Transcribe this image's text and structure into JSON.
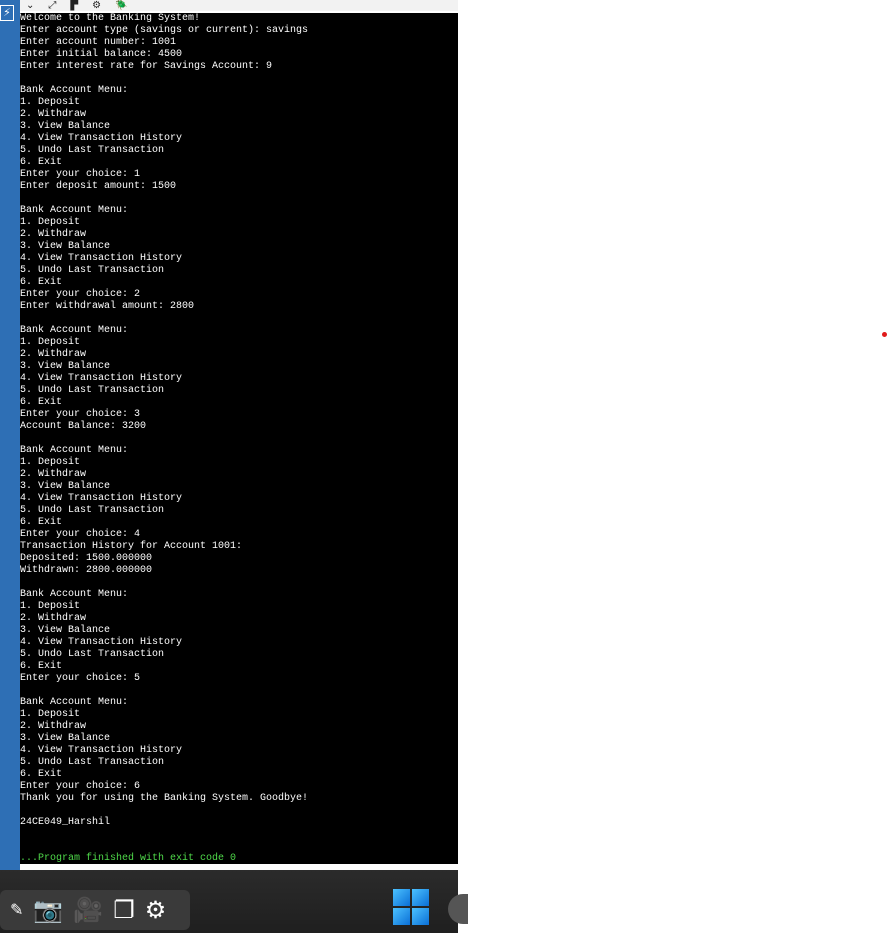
{
  "toolbar": {
    "icons": [
      "chevron-down-icon",
      "expand-icon",
      "format-icon",
      "gear-icon",
      "debug-icon"
    ],
    "glyphs": [
      "⌄",
      "⤢",
      "▛",
      "⚙",
      "🪲"
    ]
  },
  "sidebar": {
    "glyph": "⚡"
  },
  "console": {
    "lines": [
      "Welcome to the Banking System!",
      "Enter account type (savings or current): savings",
      "Enter account number: 1001",
      "Enter initial balance: 4500",
      "Enter interest rate for Savings Account: 9",
      "",
      "Bank Account Menu:",
      "1. Deposit",
      "2. Withdraw",
      "3. View Balance",
      "4. View Transaction History",
      "5. Undo Last Transaction",
      "6. Exit",
      "Enter your choice: 1",
      "Enter deposit amount: 1500",
      "",
      "Bank Account Menu:",
      "1. Deposit",
      "2. Withdraw",
      "3. View Balance",
      "4. View Transaction History",
      "5. Undo Last Transaction",
      "6. Exit",
      "Enter your choice: 2",
      "Enter withdrawal amount: 2800",
      "",
      "Bank Account Menu:",
      "1. Deposit",
      "2. Withdraw",
      "3. View Balance",
      "4. View Transaction History",
      "5. Undo Last Transaction",
      "6. Exit",
      "Enter your choice: 3",
      "Account Balance: 3200",
      "",
      "Bank Account Menu:",
      "1. Deposit",
      "2. Withdraw",
      "3. View Balance",
      "4. View Transaction History",
      "5. Undo Last Transaction",
      "6. Exit",
      "Enter your choice: 4",
      "Transaction History for Account 1001:",
      "Deposited: 1500.000000",
      "Withdrawn: 2800.000000",
      "",
      "Bank Account Menu:",
      "1. Deposit",
      "2. Withdraw",
      "3. View Balance",
      "4. View Transaction History",
      "5. Undo Last Transaction",
      "6. Exit",
      "Enter your choice: 5",
      "",
      "Bank Account Menu:",
      "1. Deposit",
      "2. Withdraw",
      "3. View Balance",
      "4. View Transaction History",
      "5. Undo Last Transaction",
      "6. Exit",
      "Enter your choice: 6",
      "Thank you for using the Banking System. Goodbye!",
      "",
      "24CE049_Harshil",
      "",
      "",
      "...Program finished with exit code 0"
    ],
    "finish_color": "#4fd94a"
  },
  "taskbar": {
    "icons": [
      "pin-icon",
      "camera-icon",
      "video-camera-icon",
      "window-stack-icon",
      "settings-gear-icon"
    ],
    "glyphs": [
      "✎",
      "📷",
      "🎥",
      "❐",
      "⚙"
    ],
    "start_icon": "windows-logo-icon"
  },
  "colors": {
    "console_bg": "#000000",
    "console_text": "#ffffff",
    "sidebar": "#2e6fb5",
    "taskbar": "#202020"
  }
}
